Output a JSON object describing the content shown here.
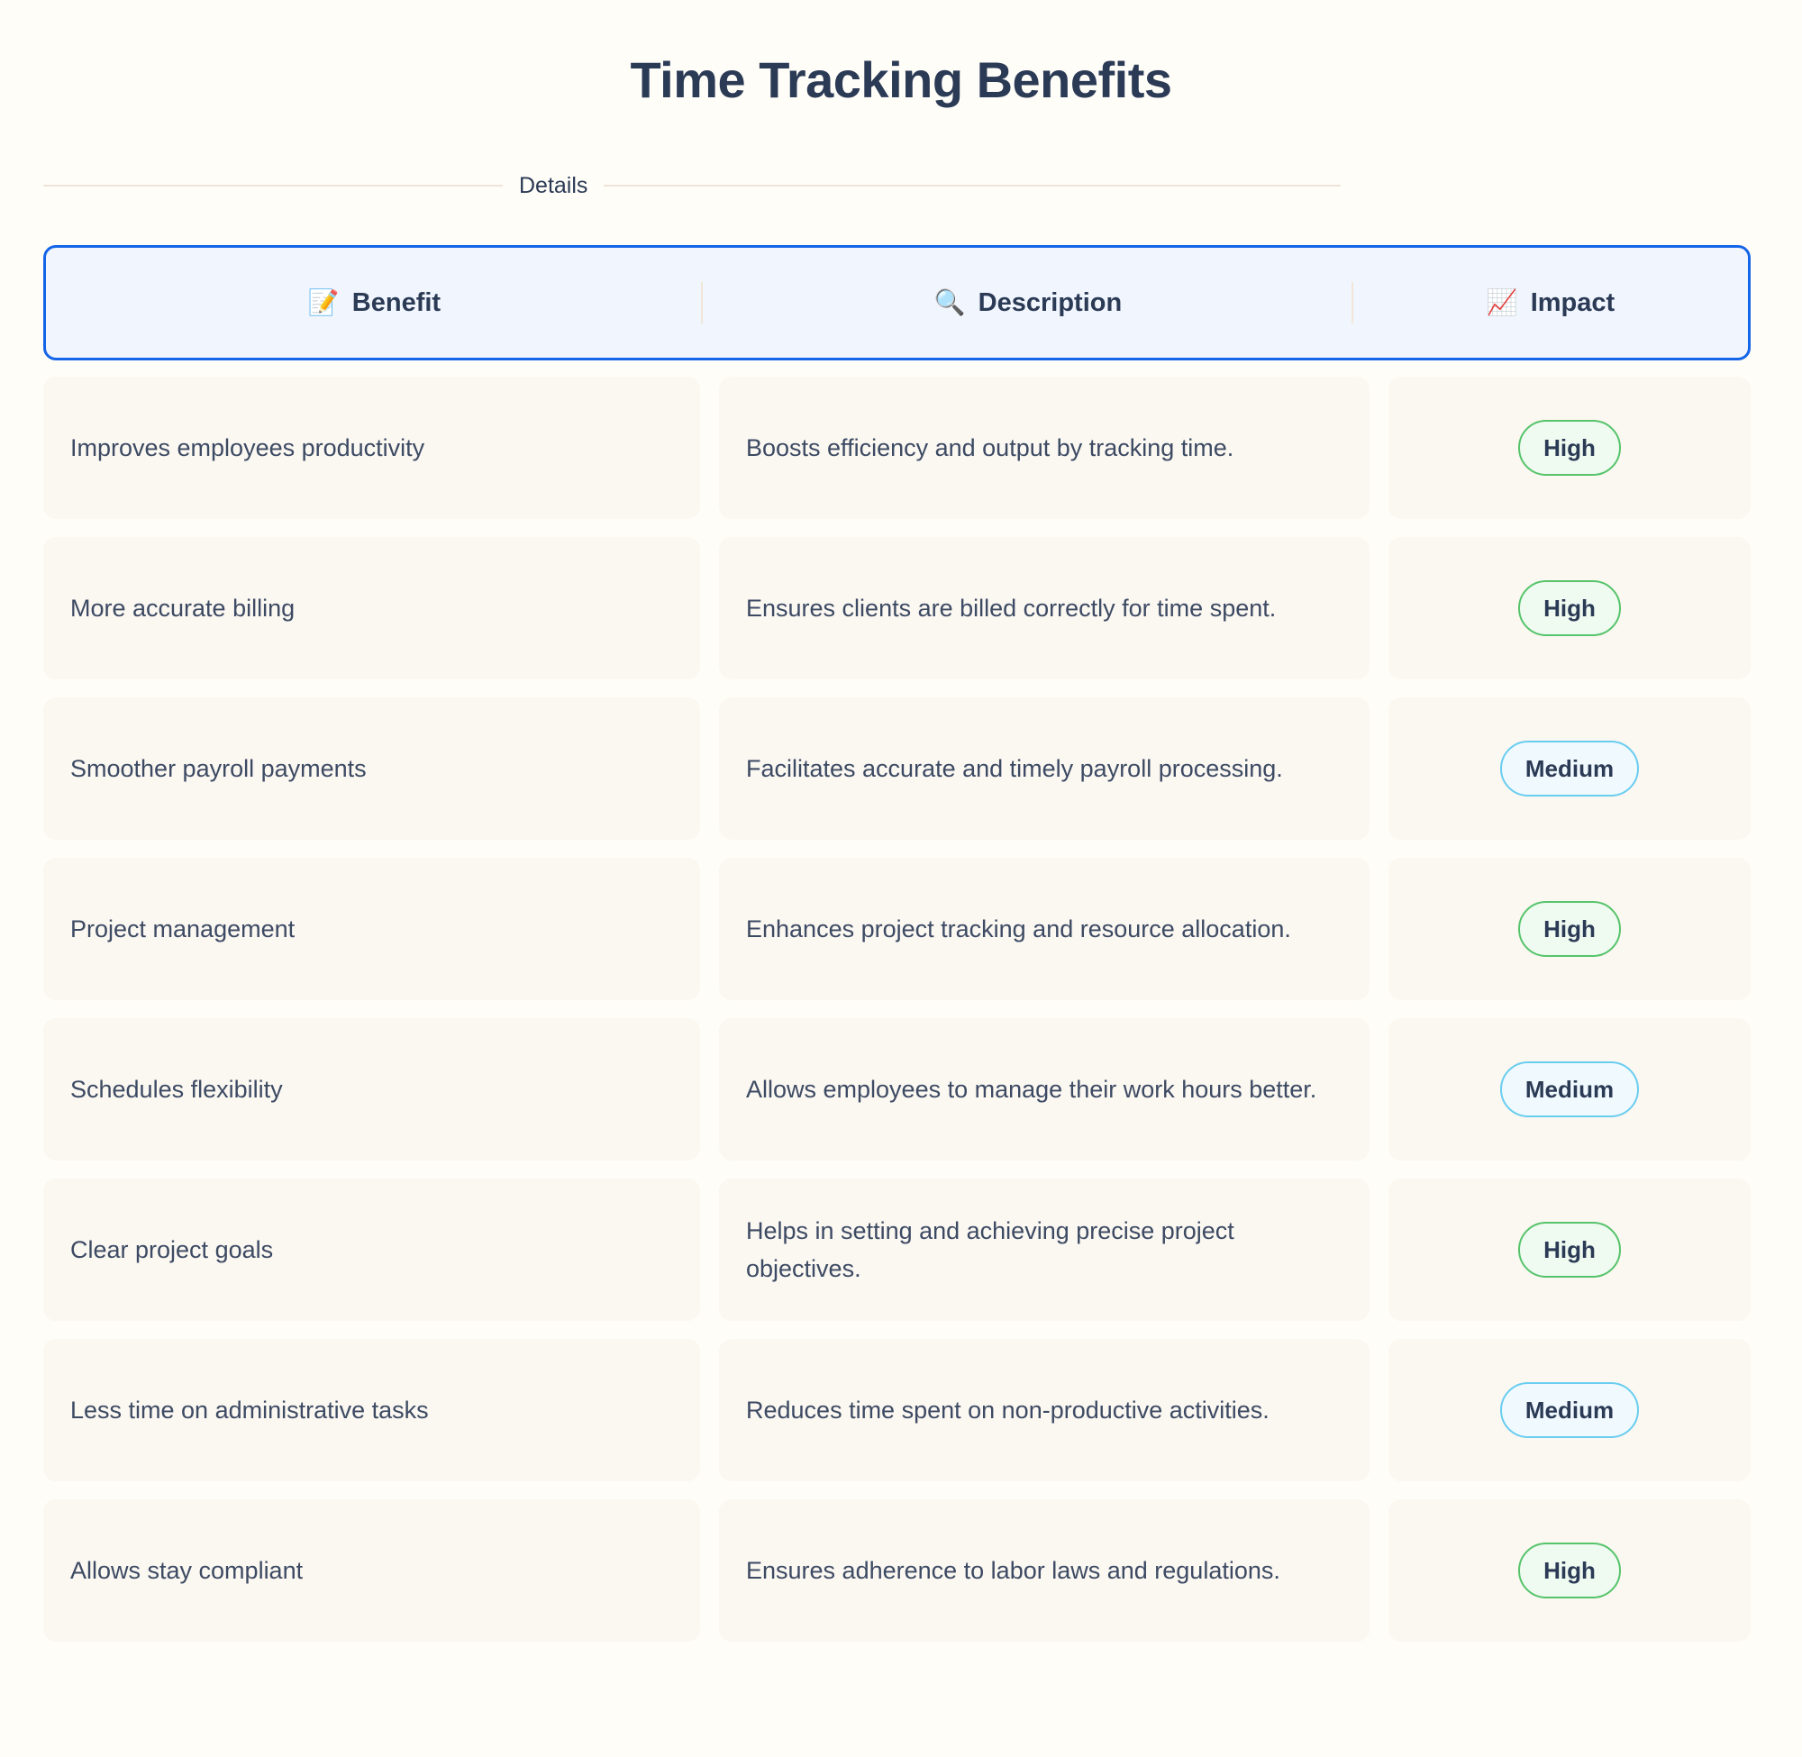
{
  "header": {
    "title": "Time Tracking Benefits",
    "section_caption": "Details"
  },
  "colors": {
    "page_background": "#FFFDF8",
    "cell_background": "#FBF7F1",
    "header_background": "#F0F5FE",
    "header_border": "#1565E8",
    "text_primary": "#2B3A55",
    "text_body": "#3C4A63",
    "divider": "#F0E3D8",
    "high_border": "#56C46B",
    "high_fill": "#EFFAF1",
    "medium_border": "#69CDF0",
    "medium_fill": "#F0FAFE"
  },
  "table": {
    "columns": [
      {
        "icon": "📝",
        "icon_name": "memo-icon",
        "label": "Benefit"
      },
      {
        "icon": "🔍",
        "icon_name": "magnifying-glass-icon",
        "label": "Description"
      },
      {
        "icon": "📈",
        "icon_name": "chart-increasing-icon",
        "label": "Impact"
      }
    ],
    "rows": [
      {
        "benefit": "Improves employees productivity",
        "description": "Boosts efficiency and output by tracking time.",
        "impact": "High",
        "impact_level": "high"
      },
      {
        "benefit": "More accurate billing",
        "description": "Ensures clients are billed correctly for time spent.",
        "impact": "High",
        "impact_level": "high"
      },
      {
        "benefit": "Smoother payroll payments",
        "description": "Facilitates accurate and timely payroll processing.",
        "impact": "Medium",
        "impact_level": "medium"
      },
      {
        "benefit": "Project management",
        "description": "Enhances project tracking and resource allocation.",
        "impact": "High",
        "impact_level": "high"
      },
      {
        "benefit": "Schedules flexibility",
        "description": "Allows employees to manage their work hours better.",
        "impact": "Medium",
        "impact_level": "medium"
      },
      {
        "benefit": "Clear project goals",
        "description": "Helps in setting and achieving precise project objectives.",
        "impact": "High",
        "impact_level": "high"
      },
      {
        "benefit": "Less time on administrative tasks",
        "description": "Reduces time spent on non-productive activities.",
        "impact": "Medium",
        "impact_level": "medium"
      },
      {
        "benefit": "Allows stay compliant",
        "description": "Ensures adherence to labor laws and regulations.",
        "impact": "High",
        "impact_level": "high"
      }
    ]
  }
}
